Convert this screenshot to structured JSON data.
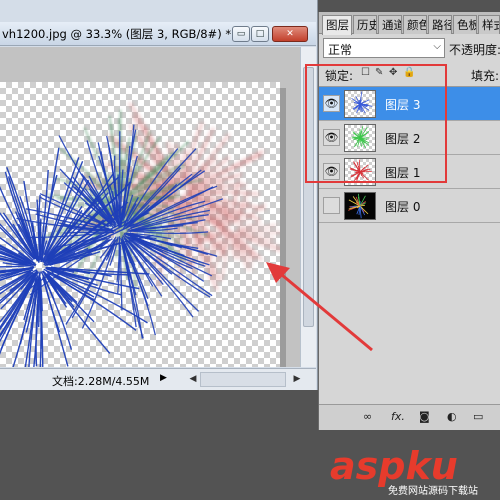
{
  "document": {
    "title": "vh1200.jpg @ 33.3% (图层 3, RGB/8#) *",
    "buttons": {
      "minimize": "▭",
      "restore": "□",
      "close": "✕"
    },
    "status": "文档:2.28M/4.55M"
  },
  "layers_panel": {
    "tabs": [
      "图层",
      "历史",
      "通道",
      "颜色",
      "路径",
      "色板",
      "样式"
    ],
    "blend_mode": "正常",
    "opacity_label": "不透明度:",
    "lock_label": "锁定:",
    "fill_label": "填充:",
    "layers": [
      {
        "name": "图层 3",
        "visible": true,
        "selected": true,
        "color": "#3a5bd9"
      },
      {
        "name": "图层 2",
        "visible": true,
        "selected": false,
        "color": "#3cc74a"
      },
      {
        "name": "图层 1",
        "visible": true,
        "selected": false,
        "color": "#d9333a"
      },
      {
        "name": "图层 0",
        "visible": false,
        "selected": false,
        "color": "#000000"
      }
    ],
    "footer_icons": [
      "link-icon",
      "fx-icon",
      "mask-icon",
      "adjustment-icon",
      "folder-icon"
    ],
    "footer_labels": {
      "fx": "fx."
    }
  },
  "icons": {
    "eye": "👁",
    "chevron_down": "⌵",
    "status_arrow": "▶",
    "scroll_left": "◀",
    "scroll_right": "▶"
  },
  "watermark": {
    "text": "aspku",
    "sub": "免费网站源码下载站"
  },
  "colors": {
    "selection": "#3d8ee8",
    "annotation_red": "#e23a3a",
    "firework_blue": "#1f3fb8",
    "firework_green": "#3f8c5a",
    "firework_red": "#c8474a"
  }
}
